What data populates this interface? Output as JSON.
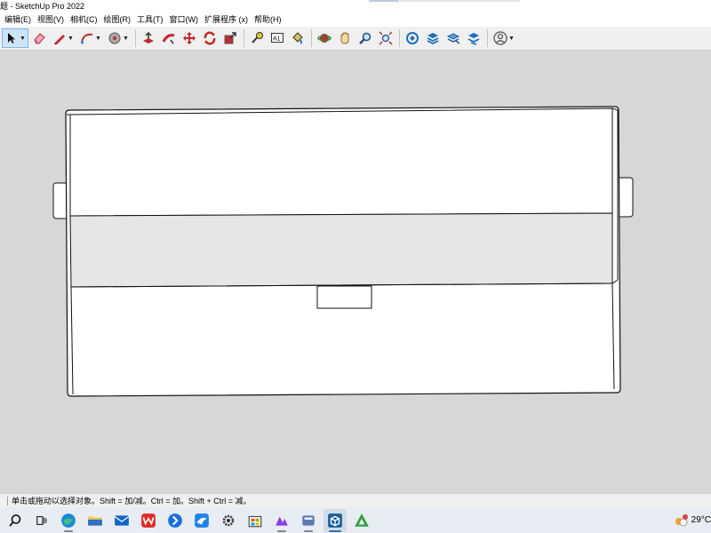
{
  "window": {
    "title": "题 - SketchUp Pro 2022"
  },
  "menu": [
    "编辑(E)",
    "视图(V)",
    "相机(C)",
    "绘图(R)",
    "工具(T)",
    "窗口(W)",
    "扩展程序 (x)",
    "帮助(H)"
  ],
  "toolbar": {
    "tools": [
      {
        "name": "select-tool",
        "icon": "cursor-arrow",
        "selected": true,
        "dropdown": true
      },
      {
        "name": "eraser-tool",
        "icon": "eraser"
      },
      {
        "name": "line-tool",
        "icon": "pencil",
        "dropdown": true
      },
      {
        "name": "arc-tool",
        "icon": "arc",
        "dropdown": true
      },
      {
        "name": "shape-tool",
        "icon": "circle-shape",
        "dropdown": true
      },
      {
        "name": "push-pull-tool",
        "icon": "push-pull"
      },
      {
        "name": "follow-me-tool",
        "icon": "follow-me"
      },
      {
        "name": "move-tool",
        "icon": "move-arrows"
      },
      {
        "name": "rotate-tool",
        "icon": "rotate"
      },
      {
        "name": "scale-tool",
        "icon": "scale"
      },
      {
        "name": "tape-measure-tool",
        "icon": "tape-measure"
      },
      {
        "name": "text-tool",
        "icon": "text-a1",
        "label": "A1"
      },
      {
        "name": "paint-bucket-tool",
        "icon": "paint-bucket"
      },
      {
        "name": "orbit-tool",
        "icon": "orbit"
      },
      {
        "name": "pan-tool",
        "icon": "hand"
      },
      {
        "name": "zoom-tool",
        "icon": "magnifier"
      },
      {
        "name": "zoom-extents-tool",
        "icon": "zoom-extents"
      },
      {
        "name": "3d-warehouse-tool",
        "icon": "warehouse"
      },
      {
        "name": "extension-warehouse-tool",
        "icon": "extension"
      },
      {
        "name": "layout-tool",
        "icon": "layers"
      },
      {
        "name": "send-to-layout-tool",
        "icon": "layout"
      },
      {
        "name": "account-tool",
        "icon": "user-circle",
        "dropdown": true
      }
    ]
  },
  "status": {
    "hint": "单击或拖动以选择对象。Shift = 加/减。Ctrl = 加。Shift + Ctrl = 减。"
  },
  "taskbar": {
    "apps": [
      "search",
      "task-view",
      "edge",
      "file-explorer",
      "mail",
      "wps",
      "app-blue",
      "app-bird",
      "settings",
      "store",
      "app-purple",
      "app-gray",
      "sketchup",
      "app-green"
    ],
    "active": "sketchup",
    "temperature": "29°C"
  },
  "colors": {
    "viewport_bg": "#d7d7d7",
    "face_white": "#ffffff",
    "face_shade": "#e6e6e6",
    "edge": "#111111",
    "select_highlight": "#cde4f7"
  }
}
